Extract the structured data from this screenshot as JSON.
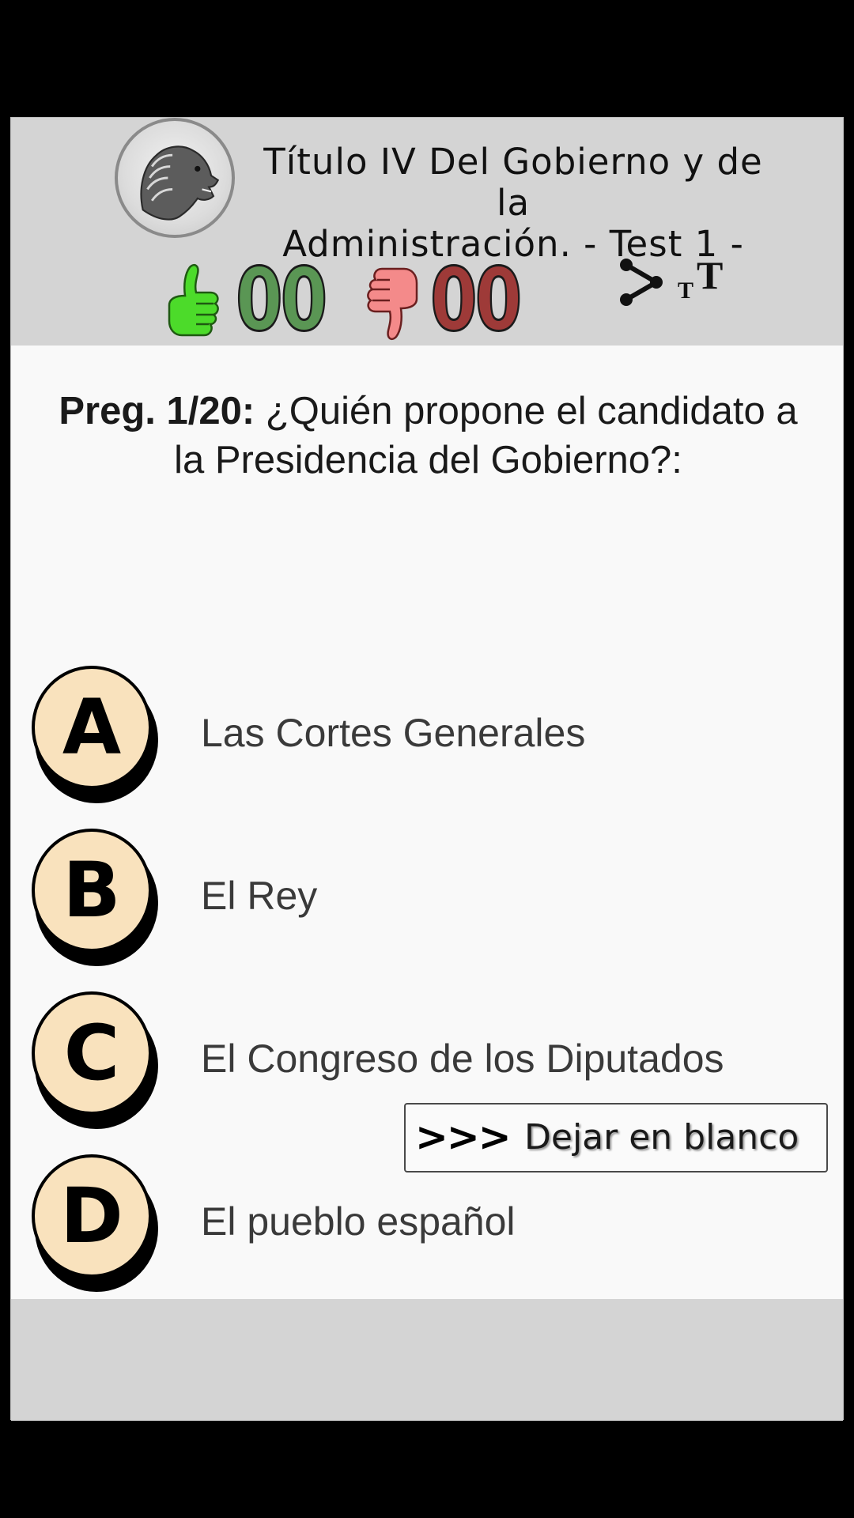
{
  "header": {
    "title_line1": "Título IV Del Gobierno y de la",
    "title_line2": "Administración. - Test 1 -",
    "correct_count": "00",
    "wrong_count": "00",
    "font_small": "T",
    "font_big": "T"
  },
  "question": {
    "prefix": "Preg. 1/20:",
    "text": "¿Quién propone el candidato a la Presidencia del Gobierno?:"
  },
  "answers": [
    {
      "letter": "A",
      "text": "Las Cortes Generales"
    },
    {
      "letter": "B",
      "text": "El Rey"
    },
    {
      "letter": "C",
      "text": "El Congreso de los Diputados"
    },
    {
      "letter": "D",
      "text": "El pueblo español"
    }
  ],
  "skip_button": {
    "arrows": ">>>",
    "label": "Dejar en blanco"
  },
  "icons": {
    "logo": "lion-icon",
    "correct": "thumbs-up-icon",
    "wrong": "thumbs-down-icon",
    "share": "share-icon",
    "font_size": "font-size-icon"
  },
  "colors": {
    "header_bg": "#d4d4d4",
    "content_bg": "#f9f9f9",
    "correct": "#5a9654",
    "wrong": "#9e3a38",
    "badge": "#f9e2bd"
  }
}
